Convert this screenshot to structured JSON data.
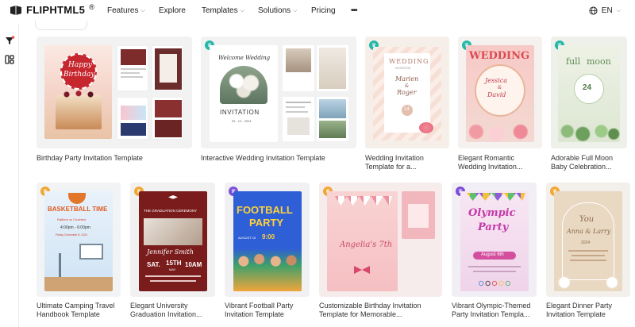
{
  "brand": {
    "name": "FLIPHTML5",
    "mark": "®"
  },
  "nav": {
    "features": "Features",
    "explore": "Explore",
    "templates": "Templates",
    "solutions": "Solutions",
    "pricing": "Pricing",
    "more": "•••"
  },
  "language": "EN",
  "icons": {
    "filter": "filter-icon",
    "layout": "layout-icon",
    "globe": "globe-icon",
    "crown": "crown-icon"
  },
  "colors": {
    "teal_badge": "#25b7a8",
    "orange_badge": "#f0a631",
    "purple_badge": "#7b4fd6"
  },
  "templates": [
    {
      "title": "Birthday Party Invitation Template",
      "badge": "none",
      "thumb": {
        "happy": "Happy",
        "birthday": "Birthday"
      }
    },
    {
      "title": "Interactive Wedding Invitation Template",
      "badge": "teal",
      "thumb": {
        "welcome": "Welcome Wedding",
        "invitation": "INVITATION",
        "date": "05 . 10 . 2024"
      }
    },
    {
      "title": "Wedding Invitation",
      "title2": "Template for a...",
      "badge": "teal",
      "thumb": {
        "wedding": "WEDDING",
        "invite": "INVITATION",
        "name1": "Marien",
        "amp": "&",
        "name2": "Roger",
        "day": "14"
      }
    },
    {
      "title": "Elegant Romantic",
      "title2": "Wedding Invitation...",
      "badge": "teal",
      "thumb": {
        "wedding": "WEDDING",
        "name1": "Jessica",
        "amp": "&",
        "name2": "David"
      }
    },
    {
      "title": "Adorable Full Moon",
      "title2": "Baby Celebration...",
      "badge": "teal",
      "thumb": {
        "full": "full",
        "moon": "moon",
        "day": "24"
      }
    },
    {
      "title": "Ultimate Camping Travel",
      "title2": "Handbook Template",
      "badge": "orange",
      "thumb": {
        "headline": "BASKETBALL TIME",
        "teams": "Rattlers  vs  Crushers",
        "time": "4:00pm - 6:00pm",
        "date": "Friday, December 8, 2024"
      }
    },
    {
      "title": "Elegant University",
      "title2": "Graduation Invitation...",
      "badge": "orange",
      "thumb": {
        "headline": "THE GRADUATION CEREMONY",
        "name": "Jennifer Smith",
        "sat": "SAT.",
        "day": "15TH",
        "month": "MAY",
        "time": "10AM"
      }
    },
    {
      "title": "Vibrant Football Party",
      "title2": "Invitation Template",
      "badge": "purple",
      "thumb": {
        "line1": "FOOTBALL",
        "line2": "PARTY",
        "date": "AUGUST 10",
        "time": "9:00"
      }
    },
    {
      "title": "Customizable Birthday Invitation",
      "title2": "Template for Memorable...",
      "badge": "orange",
      "thumb": {
        "script": "Angelia's 7th"
      }
    },
    {
      "title": "Vibrant Olympic-Themed",
      "title2": "Party Invitation Templa...",
      "badge": "purple",
      "thumb": {
        "line1": "Olympic",
        "line2": "Party",
        "date": "August 6th"
      }
    },
    {
      "title": "Elegant Dinner Party",
      "title2": "Invitation Template",
      "badge": "orange",
      "thumb": {
        "you": "You",
        "names": "Anna & Larry",
        "year": "2024"
      }
    }
  ]
}
